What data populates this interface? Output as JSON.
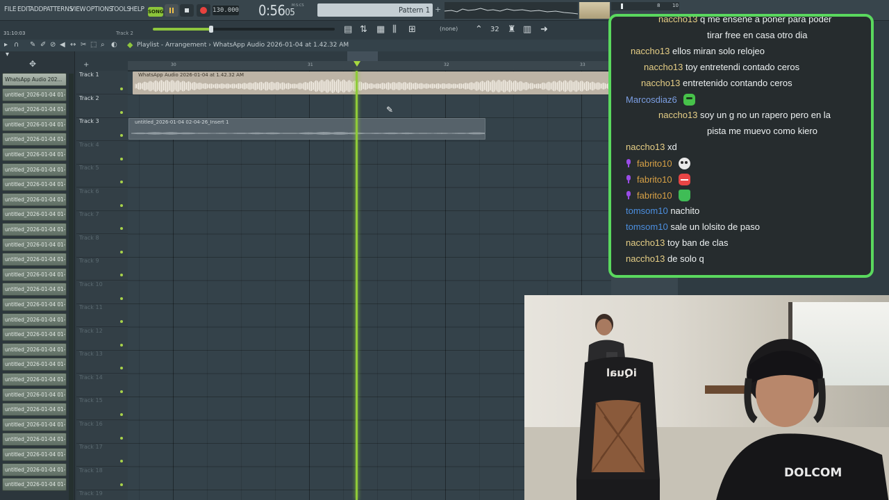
{
  "menu": [
    "FILE",
    "EDIT",
    "ADD",
    "PATTERNS",
    "VIEW",
    "OPTIONS",
    "TOOLS",
    "HELP"
  ],
  "transport": {
    "song_label": "SONG",
    "tempo": "130.000",
    "time": "0:56",
    "time_sub": "05",
    "time_unit": "M:S:CS",
    "pattern": "Pattern 1",
    "pattern_add": "+",
    "cpu_value_1": "8",
    "cpu_value_2": "10"
  },
  "hint_bar": {
    "time": "31:10:03",
    "track": "Track 2",
    "master_volume_fraction": 0.32
  },
  "toolbar": {
    "snap": "(none)"
  },
  "playlist": {
    "title": "Playlist - Arrangement",
    "separator": "›",
    "clip_name": "WhatsApp Audio 2026-01-04 at 1.42.32 AM",
    "bars": [
      "30",
      "31",
      "32",
      "33"
    ],
    "tracks": [
      "Track 1",
      "Track 2",
      "Track 3",
      "Track 4",
      "Track 5",
      "Track 6",
      "Track 7",
      "Track 8",
      "Track 9",
      "Track 10",
      "Track 11",
      "Track 12",
      "Track 13",
      "Track 14",
      "Track 15",
      "Track 16",
      "Track 17",
      "Track 18",
      "Track 19"
    ],
    "clip_1_title": "WhatsApp Audio 2026-01-04 at 1.42.32 AM",
    "clip_3_title": "untitled_2026-01-04 02-04-26_Insert 1"
  },
  "browser": {
    "items": [
      "WhatsApp Audio 202...",
      "untitled_2026-01-04 01-...",
      "untitled_2026-01-04 01-...",
      "untitled_2026-01-04 01-...",
      "untitled_2026-01-04 01-...",
      "untitled_2026-01-04 01-...",
      "untitled_2026-01-04 01-...",
      "untitled_2026-01-04 01-...",
      "untitled_2026-01-04 01-...",
      "untitled_2026-01-04 01-...",
      "untitled_2026-01-04 01-...",
      "untitled_2026-01-04 01-...",
      "untitled_2026-01-04 01-...",
      "untitled_2026-01-04 01-...",
      "untitled_2026-01-04 01-...",
      "untitled_2026-01-04 01-...",
      "untitled_2026-01-04 01-...",
      "untitled_2026-01-04 01-...",
      "untitled_2026-01-04 01-...",
      "untitled_2026-01-04 01-...",
      "untitled_2026-01-04 01-...",
      "untitled_2026-01-04 01-...",
      "untitled_2026-01-04 01-...",
      "untitled_2026-01-04 01-...",
      "untitled_2026-01-04 01-...",
      "untitled_2026-01-04 01-...",
      "untitled_2026-01-04 01-...",
      "untitled_2026-01-04 01-..."
    ]
  },
  "chat": {
    "messages": [
      {
        "user": "naccho13",
        "text": "q me enseñe a poner para poder",
        "color": "naccho"
      },
      {
        "user": "",
        "text": "tirar free en casa otro dia",
        "color": "naccho"
      },
      {
        "user": "naccho13",
        "text": "ellos miran solo relojeo",
        "color": "naccho"
      },
      {
        "user": "naccho13",
        "text": "toy entretendi contado ceros",
        "color": "naccho"
      },
      {
        "user": "naccho13",
        "text": "entretenido contando ceros",
        "color": "naccho"
      },
      {
        "user": "Marcosdiaz6",
        "text": "",
        "color": "marcos",
        "emote": "frog"
      },
      {
        "user": "naccho13",
        "text": "soy un g no un rapero pero en la",
        "color": "naccho"
      },
      {
        "user": "",
        "text": "pista me muevo como kiero",
        "color": "naccho"
      },
      {
        "user": "naccho13",
        "text": "xd",
        "color": "naccho"
      },
      {
        "user": "fabrito10",
        "text": "",
        "color": "fabrito",
        "emote": "skull",
        "badge": "mic"
      },
      {
        "user": "fabrito10",
        "text": "",
        "color": "fabrito",
        "emote": "angry",
        "badge": "mic"
      },
      {
        "user": "fabrito10",
        "text": "",
        "color": "fabrito",
        "emote": "cup",
        "badge": "mic"
      },
      {
        "user": "tomsom10",
        "text": "nachito",
        "color": "tomsom"
      },
      {
        "user": "tomsom10",
        "text": "sale un lolsito de paso",
        "color": "tomsom"
      },
      {
        "user": "naccho13",
        "text": "toy ban de clas",
        "color": "naccho"
      },
      {
        "user": "naccho13",
        "text": "de solo q",
        "color": "naccho"
      }
    ]
  },
  "webcam": {
    "chair_logo": "iQual",
    "shirt_text": "DOLCOM"
  },
  "colors": {
    "accent_green": "#8fcb39",
    "chat_border": "#5ad85e",
    "record_red": "#e8423e"
  }
}
